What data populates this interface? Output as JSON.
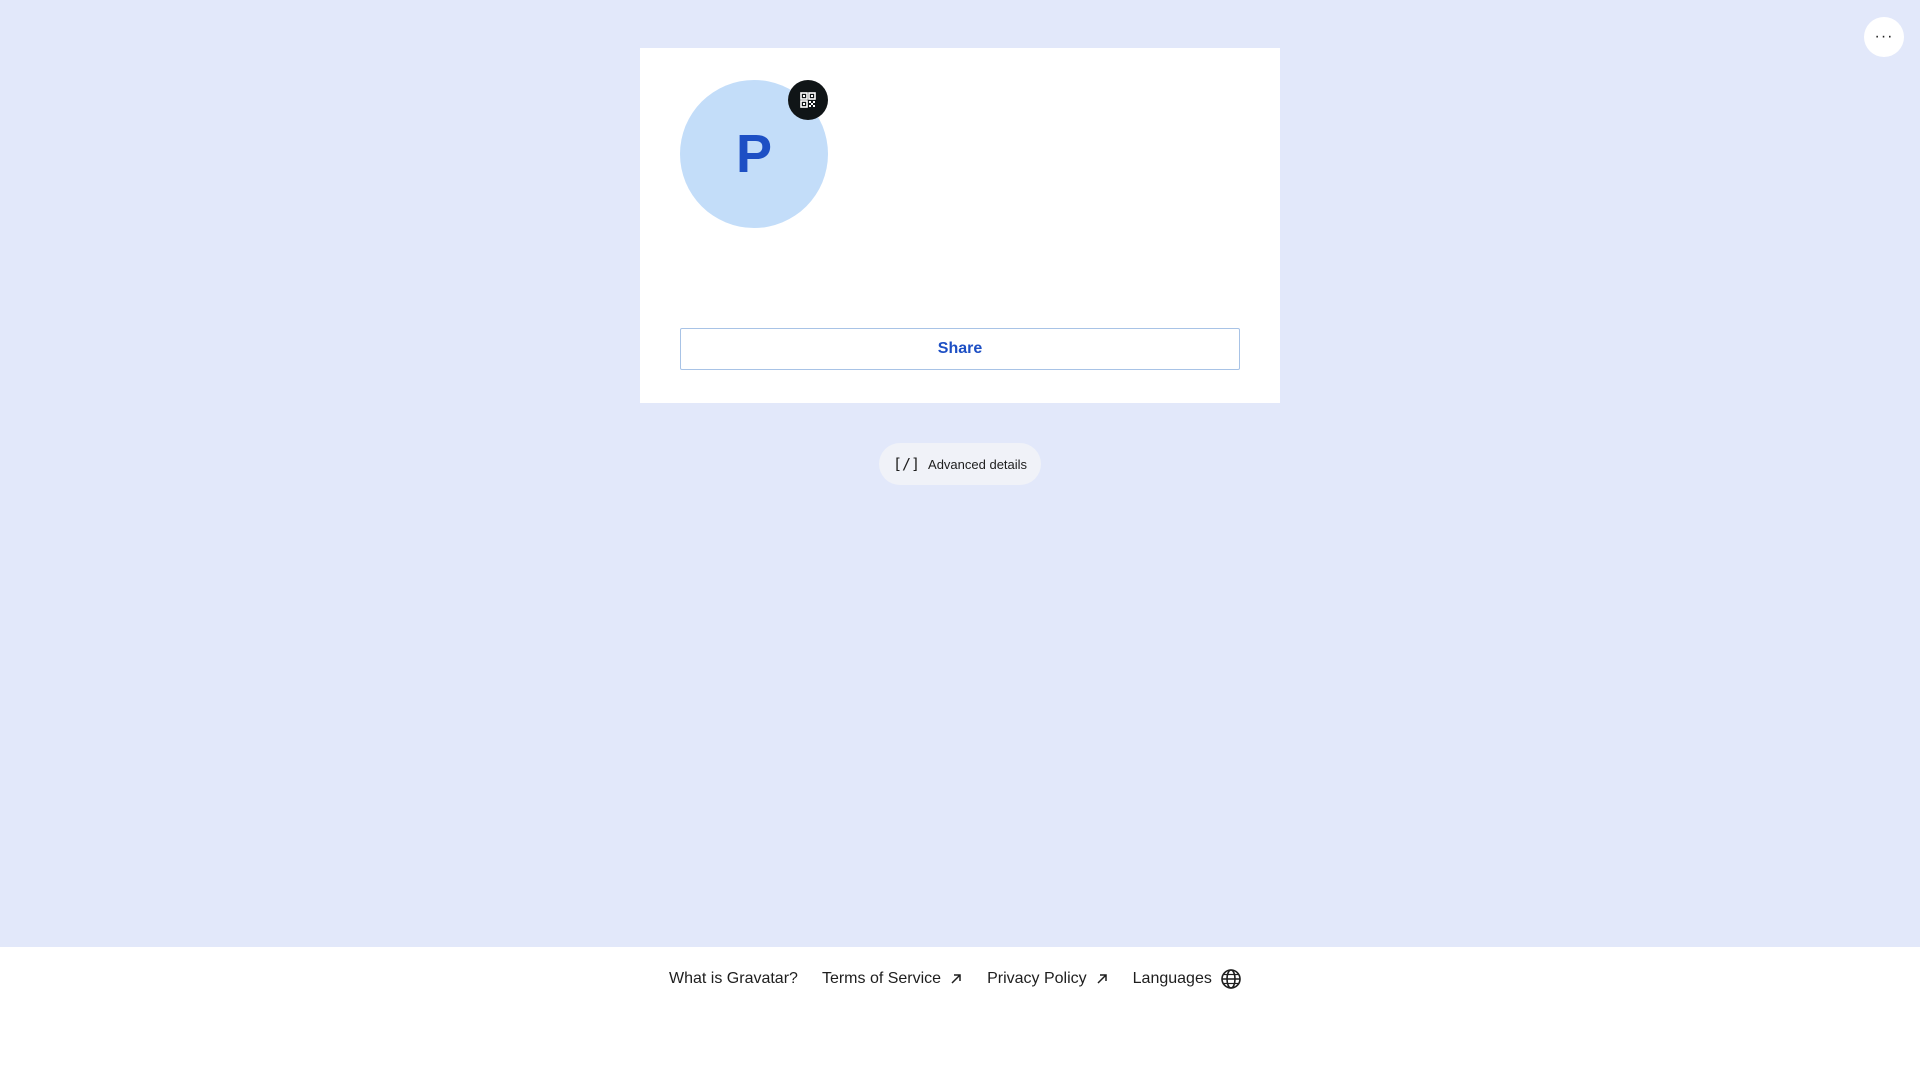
{
  "header": {
    "more_icon": "more-horizontal-icon",
    "more_label": "···"
  },
  "profile_card": {
    "avatar_initial": "P",
    "avatar_bg": "#c3ddf9",
    "avatar_text_color": "#1d4fc4",
    "qr_icon": "qr-code-icon",
    "share_label": "Share"
  },
  "advanced": {
    "icon_text": "[/]",
    "label": "Advanced details"
  },
  "footer": {
    "links": [
      {
        "label": "What is Gravatar?",
        "icon": ""
      },
      {
        "label": "Terms of Service",
        "icon": "external-arrow-icon"
      },
      {
        "label": "Privacy Policy",
        "icon": "external-arrow-icon"
      },
      {
        "label": "Languages",
        "icon": "globe-icon"
      }
    ]
  },
  "colors": {
    "page_background": "#e2e8fa",
    "accent": "#1d4fc4"
  }
}
